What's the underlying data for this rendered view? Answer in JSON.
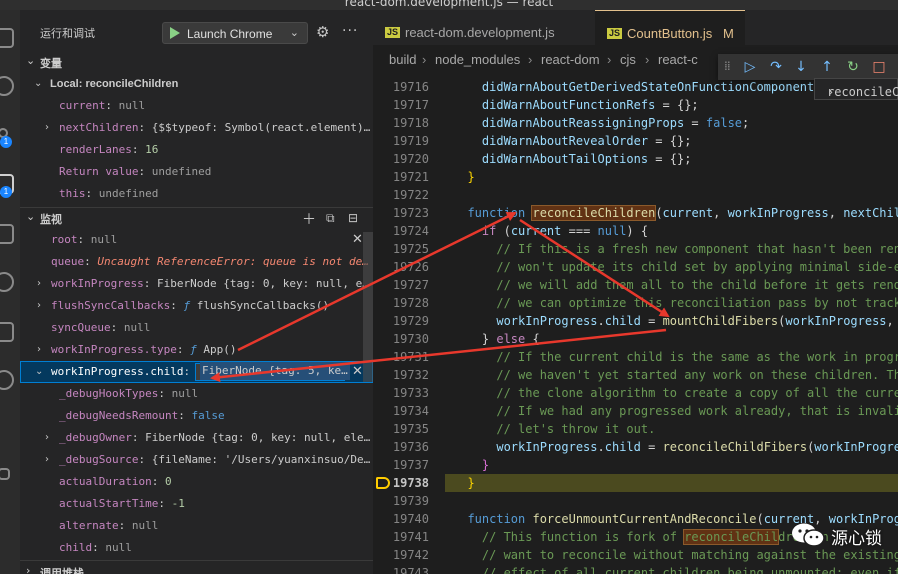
{
  "window": {
    "title": "react-dom.development.js — react"
  },
  "activity_bar": {
    "items": [
      {
        "name": "explorer-icon"
      },
      {
        "name": "search-icon"
      },
      {
        "name": "source-control-icon",
        "badge": "1"
      },
      {
        "name": "run-debug-icon",
        "badge": "1"
      },
      {
        "name": "extensions-icon"
      },
      {
        "name": "remote-icon"
      },
      {
        "name": "docker-icon"
      },
      {
        "name": "timeline-icon"
      },
      {
        "name": "testing-icon"
      }
    ]
  },
  "sidebar": {
    "title": "运行和调试",
    "launch_config": "Launch Chrome",
    "variables": {
      "header": "变量",
      "scope": "Local: reconcileChildren",
      "items": [
        {
          "name": "current",
          "value": "null",
          "kind": "null"
        },
        {
          "name": "nextChildren",
          "value": "{$$typeof: Symbol(react.element)…",
          "kind": "obj",
          "expandable": true
        },
        {
          "name": "renderLanes",
          "value": "16",
          "kind": "num"
        },
        {
          "name": "Return value",
          "value": "undefined",
          "kind": "null"
        },
        {
          "name": "this",
          "value": "undefined",
          "kind": "null"
        }
      ]
    },
    "watch": {
      "header": "监视",
      "items": [
        {
          "name": "root",
          "value": "null",
          "kind": "null"
        },
        {
          "name": "queue",
          "value": "Uncaught ReferenceError: queue is not de…",
          "kind": "err"
        },
        {
          "name": "workInProgress",
          "value": "FiberNode {tag: 0, key: null, e…",
          "kind": "obj",
          "expandable": true
        },
        {
          "name": "flushSyncCallbacks",
          "value_fn": "ƒ",
          "value": " flushSyncCallbacks()",
          "kind": "fn",
          "expandable": true
        },
        {
          "name": "syncQueue",
          "value": "null",
          "kind": "null"
        },
        {
          "name": "workInProgress.type",
          "value_fn": "ƒ",
          "value": " App()",
          "kind": "fn",
          "expandable": true
        }
      ],
      "editing": {
        "name": "workInProgress.child",
        "input_value": "FiberNode {tag: 5, ke…"
      },
      "child_items": [
        {
          "name": "_debugHookTypes",
          "value": "null",
          "kind": "null"
        },
        {
          "name": "_debugNeedsRemount",
          "value": "false",
          "kind": "bool"
        },
        {
          "name": "_debugOwner",
          "value": "FiberNode {tag: 0, key: null, ele…",
          "kind": "obj",
          "expandable": true
        },
        {
          "name": "_debugSource",
          "value": "{fileName: '/Users/yuanxinsuo/De…",
          "kind": "obj",
          "expandable": true
        },
        {
          "name": "actualDuration",
          "value": "0",
          "kind": "num"
        },
        {
          "name": "actualStartTime",
          "value": "-1",
          "kind": "num"
        },
        {
          "name": "alternate",
          "value": "null",
          "kind": "null"
        },
        {
          "name": "child",
          "value": "null",
          "kind": "null"
        }
      ]
    },
    "call_stack": {
      "header": "调用堆栈"
    }
  },
  "editor": {
    "tabs": [
      {
        "label": "react-dom.development.js",
        "active": false
      },
      {
        "label": "CountButton.js",
        "modified": "M",
        "active": true
      }
    ],
    "breadcrumbs": [
      "build",
      "node_modules",
      "react-dom",
      "cjs",
      "react-c"
    ],
    "hover_value": "reconcileC",
    "current_line": "19738",
    "lines": [
      {
        "n": "19716",
        "tokens": [
          [
            "    ",
            "p"
          ],
          [
            "didWarnAboutGetDerivedStateOnFunctionComponent = {};",
            "var"
          ]
        ]
      },
      {
        "n": "19717",
        "tokens": [
          [
            "    ",
            "p"
          ],
          [
            "didWarnAboutFunctionRefs",
            "var"
          ],
          [
            " = {};",
            "p"
          ]
        ]
      },
      {
        "n": "19718",
        "tokens": [
          [
            "    ",
            "p"
          ],
          [
            "didWarnAboutReassigningProps",
            "var"
          ],
          [
            " = ",
            "p"
          ],
          [
            "false",
            "kw"
          ],
          [
            ";",
            "p"
          ]
        ]
      },
      {
        "n": "19719",
        "tokens": [
          [
            "    ",
            "p"
          ],
          [
            "didWarnAboutRevealOrder",
            "var"
          ],
          [
            " = {};",
            "p"
          ]
        ]
      },
      {
        "n": "19720",
        "tokens": [
          [
            "    ",
            "p"
          ],
          [
            "didWarnAboutTailOptions",
            "var"
          ],
          [
            " = {};",
            "p"
          ]
        ]
      },
      {
        "n": "19721",
        "tokens": [
          [
            "  }",
            "brace"
          ]
        ]
      },
      {
        "n": "19722",
        "tokens": []
      },
      {
        "n": "19723",
        "tokens": [
          [
            "  ",
            "p"
          ],
          [
            "function",
            "kw"
          ],
          [
            " ",
            "p"
          ],
          [
            "reconcileChildren",
            "fnmatch"
          ],
          [
            "(",
            "p"
          ],
          [
            "current",
            "var"
          ],
          [
            ", ",
            "p"
          ],
          [
            "workInProgress",
            "var"
          ],
          [
            ", ",
            "p"
          ],
          [
            "nextChildren",
            "var"
          ]
        ]
      },
      {
        "n": "19724",
        "tokens": [
          [
            "    ",
            "p"
          ],
          [
            "if",
            "ctl"
          ],
          [
            " (",
            "p"
          ],
          [
            "current",
            "var"
          ],
          [
            " === ",
            "p"
          ],
          [
            "null",
            "kw"
          ],
          [
            ") {",
            "p"
          ]
        ]
      },
      {
        "n": "19725",
        "tokens": [
          [
            "      ",
            "p"
          ],
          [
            "// If this is a fresh new component that hasn't been rendere",
            "cmt"
          ]
        ]
      },
      {
        "n": "19726",
        "tokens": [
          [
            "      ",
            "p"
          ],
          [
            "// won't update its child set by applying minimal side-effe",
            "cmt"
          ]
        ]
      },
      {
        "n": "19727",
        "tokens": [
          [
            "      ",
            "p"
          ],
          [
            "// we will add them all to the child before it gets rendere",
            "cmt"
          ]
        ]
      },
      {
        "n": "19728",
        "tokens": [
          [
            "      ",
            "p"
          ],
          [
            "// we can optimize this reconciliation pass by not tracking",
            "cmt"
          ]
        ]
      },
      {
        "n": "19729",
        "tokens": [
          [
            "      ",
            "p"
          ],
          [
            "workInProgress",
            "var"
          ],
          [
            ".",
            "p"
          ],
          [
            "child",
            "var"
          ],
          [
            " = ",
            "p"
          ],
          [
            "mountChildFibers",
            "fn"
          ],
          [
            "(",
            "p"
          ],
          [
            "workInProgress",
            "var"
          ],
          [
            ", ",
            "p"
          ],
          [
            "nul",
            "var"
          ]
        ]
      },
      {
        "n": "19730",
        "tokens": [
          [
            "    } ",
            "p"
          ],
          [
            "else",
            "ctl"
          ],
          [
            " {",
            "p"
          ]
        ]
      },
      {
        "n": "19731",
        "tokens": [
          [
            "      ",
            "p"
          ],
          [
            "// If the current child is the same as the work in progress",
            "cmt"
          ]
        ]
      },
      {
        "n": "19732",
        "tokens": [
          [
            "      ",
            "p"
          ],
          [
            "// we haven't yet started any work on these children. There",
            "cmt"
          ]
        ]
      },
      {
        "n": "19733",
        "tokens": [
          [
            "      ",
            "p"
          ],
          [
            "// the clone algorithm to create a copy of all the current",
            "cmt"
          ]
        ]
      },
      {
        "n": "19734",
        "tokens": [
          [
            "      ",
            "p"
          ],
          [
            "// If we had any progressed work already, that is invalid",
            "cmt"
          ]
        ]
      },
      {
        "n": "19735",
        "tokens": [
          [
            "      ",
            "p"
          ],
          [
            "// let's throw it out.",
            "cmt"
          ]
        ]
      },
      {
        "n": "19736",
        "tokens": [
          [
            "      ",
            "p"
          ],
          [
            "workInProgress",
            "var"
          ],
          [
            ".",
            "p"
          ],
          [
            "child",
            "var"
          ],
          [
            " = ",
            "p"
          ],
          [
            "reconcileChildFibers",
            "fn"
          ],
          [
            "(",
            "p"
          ],
          [
            "workInProgress",
            "var"
          ]
        ]
      },
      {
        "n": "19737",
        "tokens": [
          [
            "    }",
            "brace2"
          ]
        ]
      },
      {
        "n": "19738",
        "tokens": [
          [
            "  }",
            "brace"
          ]
        ]
      },
      {
        "n": "19739",
        "tokens": []
      },
      {
        "n": "19740",
        "tokens": [
          [
            "  ",
            "p"
          ],
          [
            "function",
            "kw"
          ],
          [
            " ",
            "p"
          ],
          [
            "forceUnmountCurrentAndReconcile",
            "fn"
          ],
          [
            "(",
            "p"
          ],
          [
            "current",
            "var"
          ],
          [
            ", ",
            "p"
          ],
          [
            "workInProgre",
            "var"
          ]
        ]
      },
      {
        "n": "19741",
        "tokens": [
          [
            "    ",
            "p"
          ],
          [
            "// This function is fork of ",
            "cmt"
          ],
          [
            "reconcileChil",
            "cmtmatch"
          ],
          [
            "dren",
            "cmt"
          ],
          [
            " in",
            "cmt"
          ]
        ]
      },
      {
        "n": "19742",
        "tokens": [
          [
            "    ",
            "p"
          ],
          [
            "// want to reconcile without matching against the existing s",
            "cmt"
          ]
        ]
      },
      {
        "n": "19743",
        "tokens": [
          [
            "    ",
            "p"
          ],
          [
            "// effect of all current children being unmounted; even if t",
            "cmt"
          ]
        ]
      }
    ]
  },
  "watermark": {
    "text": "源心锁"
  }
}
